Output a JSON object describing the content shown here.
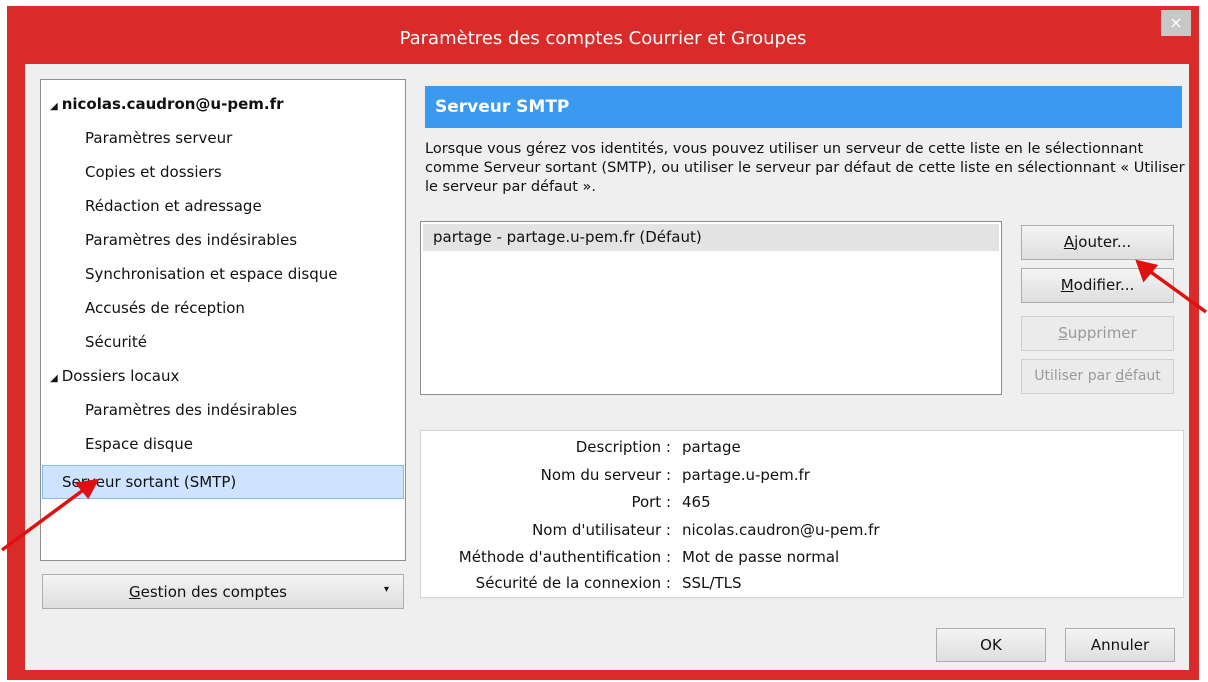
{
  "window": {
    "title": "Paramètres des comptes Courrier et Groupes",
    "close_glyph": "×"
  },
  "tree": {
    "items": [
      {
        "label": "nicolas.caudron@u-pem.fr",
        "expander": "◢"
      },
      {
        "label": "Paramètres serveur"
      },
      {
        "label": "Copies et dossiers"
      },
      {
        "label": "Rédaction et adressage"
      },
      {
        "label": "Paramètres des indésirables"
      },
      {
        "label": "Synchronisation et espace disque"
      },
      {
        "label": "Accusés de réception"
      },
      {
        "label": "Sécurité"
      },
      {
        "label": "Dossiers locaux",
        "expander": "◢"
      },
      {
        "label": "Paramètres des indésirables"
      },
      {
        "label": "Espace disque"
      },
      {
        "label": "Serveur sortant (SMTP)"
      }
    ]
  },
  "accounts_button": {
    "label_u": "G",
    "label_rest": "estion des comptes",
    "arrow": "▾"
  },
  "panel": {
    "header": "Serveur SMTP",
    "description": "Lorsque vous gérez vos identités, vous pouvez utiliser un serveur de cette liste en le sélectionnant comme Serveur sortant (SMTP), ou utiliser le serveur par défaut de cette liste en sélectionnant « Utiliser le serveur par défaut ».",
    "server_row": "partage - partage.u-pem.fr (Défaut)"
  },
  "buttons": {
    "add": {
      "pre": "",
      "u": "A",
      "post": "jouter..."
    },
    "modify": {
      "pre": "",
      "u": "M",
      "post": "odifier..."
    },
    "delete": {
      "pre": "",
      "u": "S",
      "post": "upprimer"
    },
    "default": {
      "pre": "Utiliser par ",
      "u": "d",
      "post": "éfaut"
    },
    "ok": "OK",
    "cancel": "Annuler"
  },
  "details": {
    "rows": [
      {
        "label": "Description :",
        "value": "partage"
      },
      {
        "label": "Nom du serveur :",
        "value": "partage.u-pem.fr"
      },
      {
        "label": "Port :",
        "value": "465"
      },
      {
        "label": "Nom d'utilisateur :",
        "value": "nicolas.caudron@u-pem.fr"
      },
      {
        "label": "Méthode d'authentification :",
        "value": "Mot de passe normal"
      },
      {
        "label": "Sécurité de la connexion :",
        "value": "SSL/TLS"
      }
    ]
  },
  "colors": {
    "frame": "#db2a2a",
    "header": "#3b99f0",
    "selection": "#cde3ff",
    "annotation_arrow": "#e01010"
  }
}
